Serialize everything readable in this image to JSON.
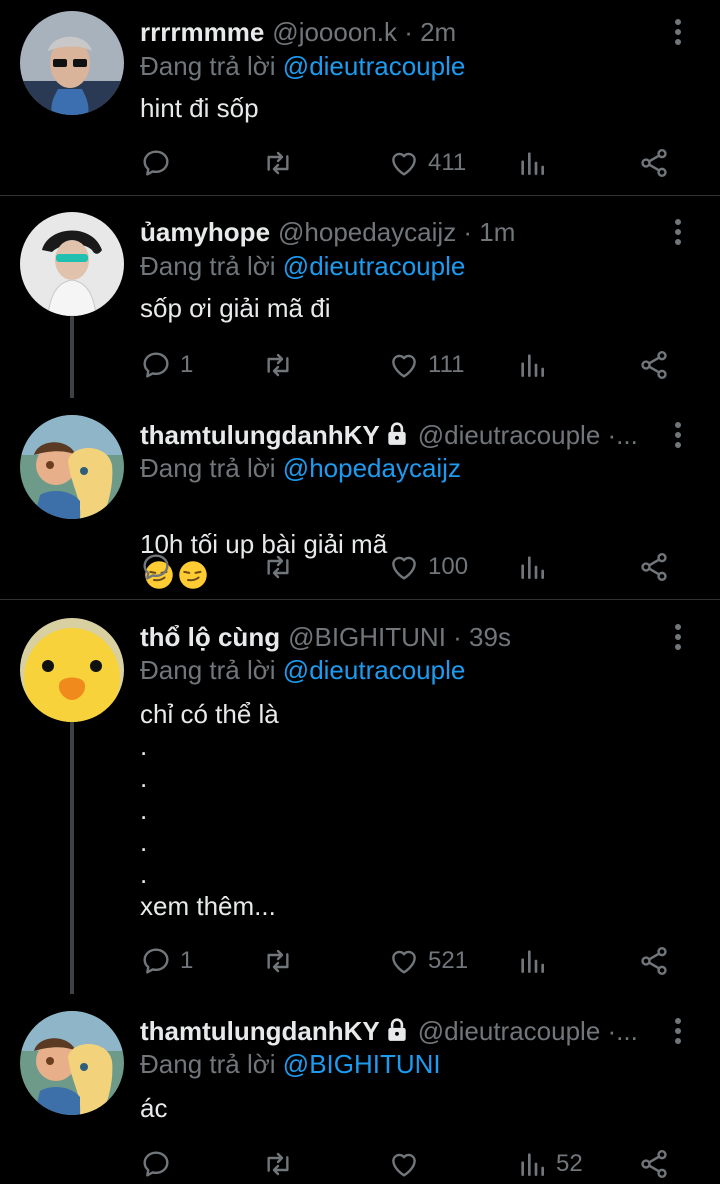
{
  "colors": {
    "background": "#000000",
    "text": "#e7e9ea",
    "muted": "#71767b",
    "link": "#1d9bf0",
    "divider": "#2f3336"
  },
  "tweets": [
    {
      "name": "rrrrmmme",
      "handle": "@joooon.k · 2m",
      "reply_prefix": "Đang trả lời",
      "reply_to": "@dieutracouple",
      "text": "hint đi sốp",
      "replies": "",
      "retweets": "",
      "likes": "411",
      "views": "",
      "avatar_icon": "avatar-photo"
    },
    {
      "name": "ủamyhope",
      "handle": "@hopedaycaijz · 1m",
      "reply_prefix": "Đang trả lời",
      "reply_to": "@dieutracouple",
      "text": "sốp ơi giải mã đi",
      "replies": "1",
      "retweets": "",
      "likes": "111",
      "views": "",
      "avatar_icon": "avatar-photo"
    },
    {
      "name": "thamtulungdanhKY",
      "handle": "@dieutracouple ·...",
      "reply_prefix": "Đang trả lời",
      "reply_to": "@hopedaycaijz",
      "text": "10h tối up bài giải mã",
      "emoji": "smirking-face-icon",
      "replies": "",
      "retweets": "",
      "likes": "100",
      "views": "",
      "avatar_icon": "avatar-cartoon"
    },
    {
      "name": "thổ lộ cùng",
      "handle": "@BIGHITUNI · 39s",
      "reply_prefix": "Đang trả lời",
      "reply_to": "@dieutracouple",
      "text": "chỉ có thể là\n.\n.\n.\n.\n.\nxem thêm...",
      "replies": "1",
      "retweets": "",
      "likes": "521",
      "views": "",
      "avatar_icon": "avatar-duck"
    },
    {
      "name": "thamtulungdanhKY",
      "handle": "@dieutracouple ·...",
      "reply_prefix": "Đang trả lời",
      "reply_to": "@BIGHITUNI",
      "text": "ác",
      "replies": "",
      "retweets": "",
      "likes": "",
      "views": "52",
      "avatar_icon": "avatar-cartoon"
    }
  ]
}
